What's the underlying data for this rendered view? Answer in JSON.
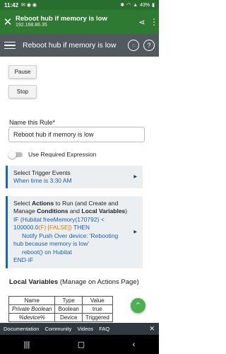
{
  "status_bar": {
    "time": "11:42",
    "battery": "43%"
  },
  "browser": {
    "title": "Reboot hub if memory is low",
    "url": "192.168.86.35"
  },
  "header": {
    "title": "Reboot hub if memory is low"
  },
  "buttons": {
    "pause": "Pause",
    "stop": "Stop"
  },
  "rule_name": {
    "label": "Name this Rule*",
    "value": "Reboot hub if memory is low"
  },
  "required_expression": {
    "label": "Use Required Expression",
    "enabled": false
  },
  "trigger": {
    "title": "Select Trigger Events",
    "summary": "When time is 3:30 AM"
  },
  "actions": {
    "title_pre": "Select ",
    "title_b1": "Actions",
    "title_mid": " to Run (and Create and Manage ",
    "title_b2": "Conditions",
    "title_and": " and ",
    "title_b3": "Local Variables",
    "title_post": ")",
    "if_text": "IF (Hubitat freeMemory(170792) <",
    "if_text2": "100000.0",
    "if_flag": "(F) [FALSE])",
    "then_text": "THEN",
    "notify_line1": "Notify Push Over device: 'Rebooting",
    "notify_line2": "hub because memory is low'",
    "reboot_line": "reboot() on Hubitat",
    "endif": "END-IF"
  },
  "local_vars": {
    "title_b": "Local Variables",
    "title_rest": " (Manage on Actions Page)",
    "headers": [
      "Name",
      "Type",
      "Value"
    ],
    "rows": [
      [
        "Private Boolean",
        "Boolean",
        "true"
      ],
      [
        "%device%",
        "Device",
        "Triggered"
      ]
    ]
  },
  "footer": {
    "links": [
      "Documentation",
      "Community",
      "Videos",
      "FAQ"
    ]
  },
  "colors": {
    "browser_bar": "#2f7a33",
    "header_bg": "#505a5e",
    "accent_blue": "#1a5fb4",
    "false_orange": "#e07b00",
    "fab_green": "#4caf50"
  }
}
